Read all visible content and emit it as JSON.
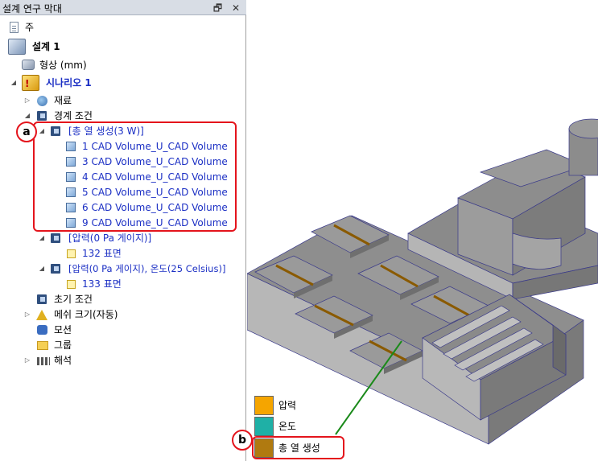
{
  "panel": {
    "title": "설계 연구 막대",
    "buttons": "🗗 ✕"
  },
  "tree": {
    "main": "주",
    "design": "설계 1",
    "geometry": "형상 (mm)",
    "scenario": "시나리오 1",
    "materials": "재료",
    "boundary": "경계 조건",
    "heat_group": "[총 열 생성(3 W)]",
    "heat_items": [
      "1 CAD Volume_U_CAD Volume",
      "3 CAD Volume_U_CAD Volume",
      "4 CAD Volume_U_CAD Volume",
      "5 CAD Volume_U_CAD Volume",
      "6 CAD Volume_U_CAD Volume",
      "9 CAD Volume_U_CAD Volume"
    ],
    "pressure_group": "[압력(0 Pa 게이지)]",
    "pressure_face": "132 표면",
    "pt_group": "[압력(0 Pa 게이지), 온도(25 Celsius)]",
    "pt_face": "133 표면",
    "initial": "초기 조건",
    "mesh": "메쉬 크기(자동)",
    "motion": "모션",
    "groups": "그룹",
    "analysis": "해석"
  },
  "callouts": {
    "a": "a",
    "b": "b"
  },
  "legend": [
    {
      "label": "압력",
      "color": "#f5a500"
    },
    {
      "label": "온도",
      "color": "#1fb0a6"
    },
    {
      "label": "총 열 생성",
      "color": "#b07a10"
    }
  ],
  "colors": {
    "callout": "#e4141c",
    "tree_link": "#1b2fc4",
    "leader_line": "#1a8a1a",
    "model_fill": "#8c8c8c"
  }
}
